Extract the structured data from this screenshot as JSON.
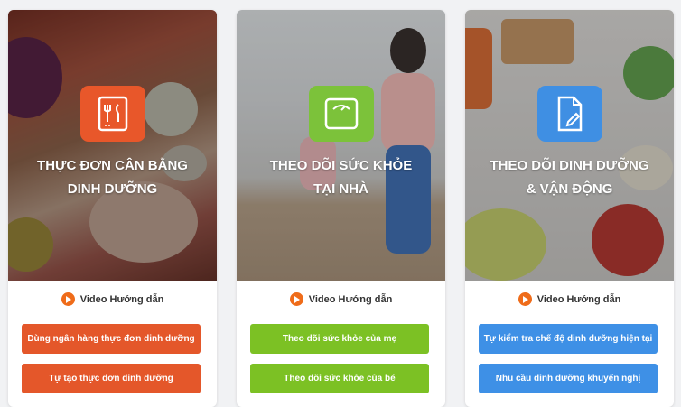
{
  "colors": {
    "orange_accent": "#e4572a",
    "green_accent": "#7cc124",
    "blue_accent": "#3e90e6",
    "play_icon": "#ef6c1a"
  },
  "cards": [
    {
      "title_line1": "Thực đơn cân bằng",
      "title_line2": "dinh dưỡng",
      "icon": "menu-cutlery-icon",
      "video_label": "Video Hướng dẫn",
      "button1": "Dùng ngân hàng thực đơn dinh dưỡng",
      "button2": "Tự tạo thực đơn dinh dưỡng"
    },
    {
      "title_line1": "Theo dõi sức khỏe",
      "title_line2": "tại nhà",
      "icon": "scale-icon",
      "video_label": "Video Hướng dẫn",
      "button1": "Theo dõi sức khỏe của mẹ",
      "button2": "Theo dõi sức khỏe của bé"
    },
    {
      "title_line1": "Theo dõi dinh dưỡng",
      "title_line2": "& vận động",
      "icon": "document-edit-icon",
      "video_label": "Video Hướng dẫn",
      "button1": "Tự kiểm tra chế độ dinh dưỡng hiện tại",
      "button2": "Nhu cầu dinh dưỡng khuyến nghị"
    }
  ]
}
